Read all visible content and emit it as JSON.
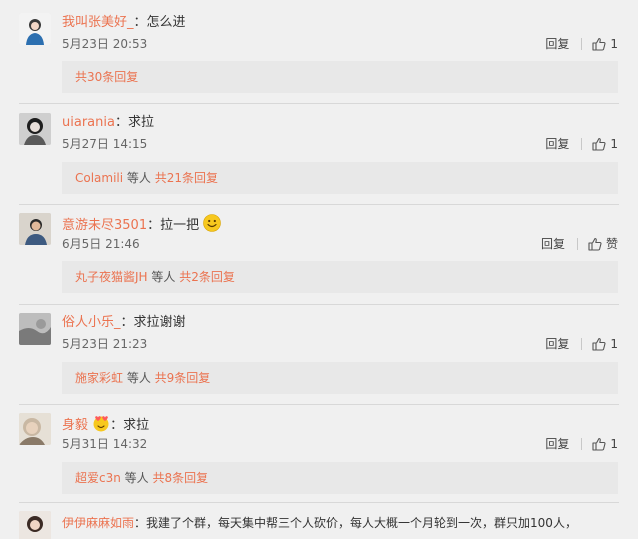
{
  "comments": [
    {
      "username": "我叫张美好_",
      "colon": "：",
      "text": "怎么进",
      "time": "5月23日 20:53",
      "reply_label": "回复",
      "like_count": "1",
      "reply_box": {
        "prefix_name": "",
        "prefix_text": "",
        "link_text": "共30条回复"
      }
    },
    {
      "username": "uiarania",
      "colon": "：",
      "text": "求拉",
      "time": "5月27日 14:15",
      "reply_label": "回复",
      "like_count": "1",
      "reply_box": {
        "prefix_name": "Colamili",
        "prefix_text": " 等人 ",
        "link_text": "共21条回复"
      }
    },
    {
      "username": "意游未尽3501",
      "colon": "：",
      "text": "拉一把",
      "time": "6月5日 21:46",
      "reply_label": "回复",
      "like_count": "赞",
      "reply_box": {
        "prefix_name": "丸子夜猫酱JH",
        "prefix_text": " 等人 ",
        "link_text": "共2条回复"
      }
    },
    {
      "username": "俗人小乐_",
      "colon": "：",
      "text": "求拉谢谢",
      "time": "5月23日 21:23",
      "reply_label": "回复",
      "like_count": "1",
      "reply_box": {
        "prefix_name": "施家彩虹",
        "prefix_text": " 等人 ",
        "link_text": "共9条回复"
      }
    },
    {
      "username": "身毅",
      "colon": "：",
      "text": "求拉",
      "time": "5月31日 14:32",
      "reply_label": "回复",
      "like_count": "1",
      "reply_box": {
        "prefix_name": "超爱c3n",
        "prefix_text": " 等人 ",
        "link_text": "共8条回复"
      }
    }
  ],
  "last_comment": {
    "username": "伊伊麻麻如雨",
    "colon": "：",
    "text": "我建了个群，每天集中帮三个人砍价，每人大概一个月轮到一次，群只加100人，"
  },
  "colors": {
    "background": "#f0f0f0",
    "username": "#eb7350",
    "reply_box": "#e8e8e8",
    "text": "#333333"
  },
  "icons": {
    "like": "thumbs-up-icon",
    "emoji_smile": "smile-emoji-icon",
    "emoji_love": "love-emoji-icon"
  }
}
